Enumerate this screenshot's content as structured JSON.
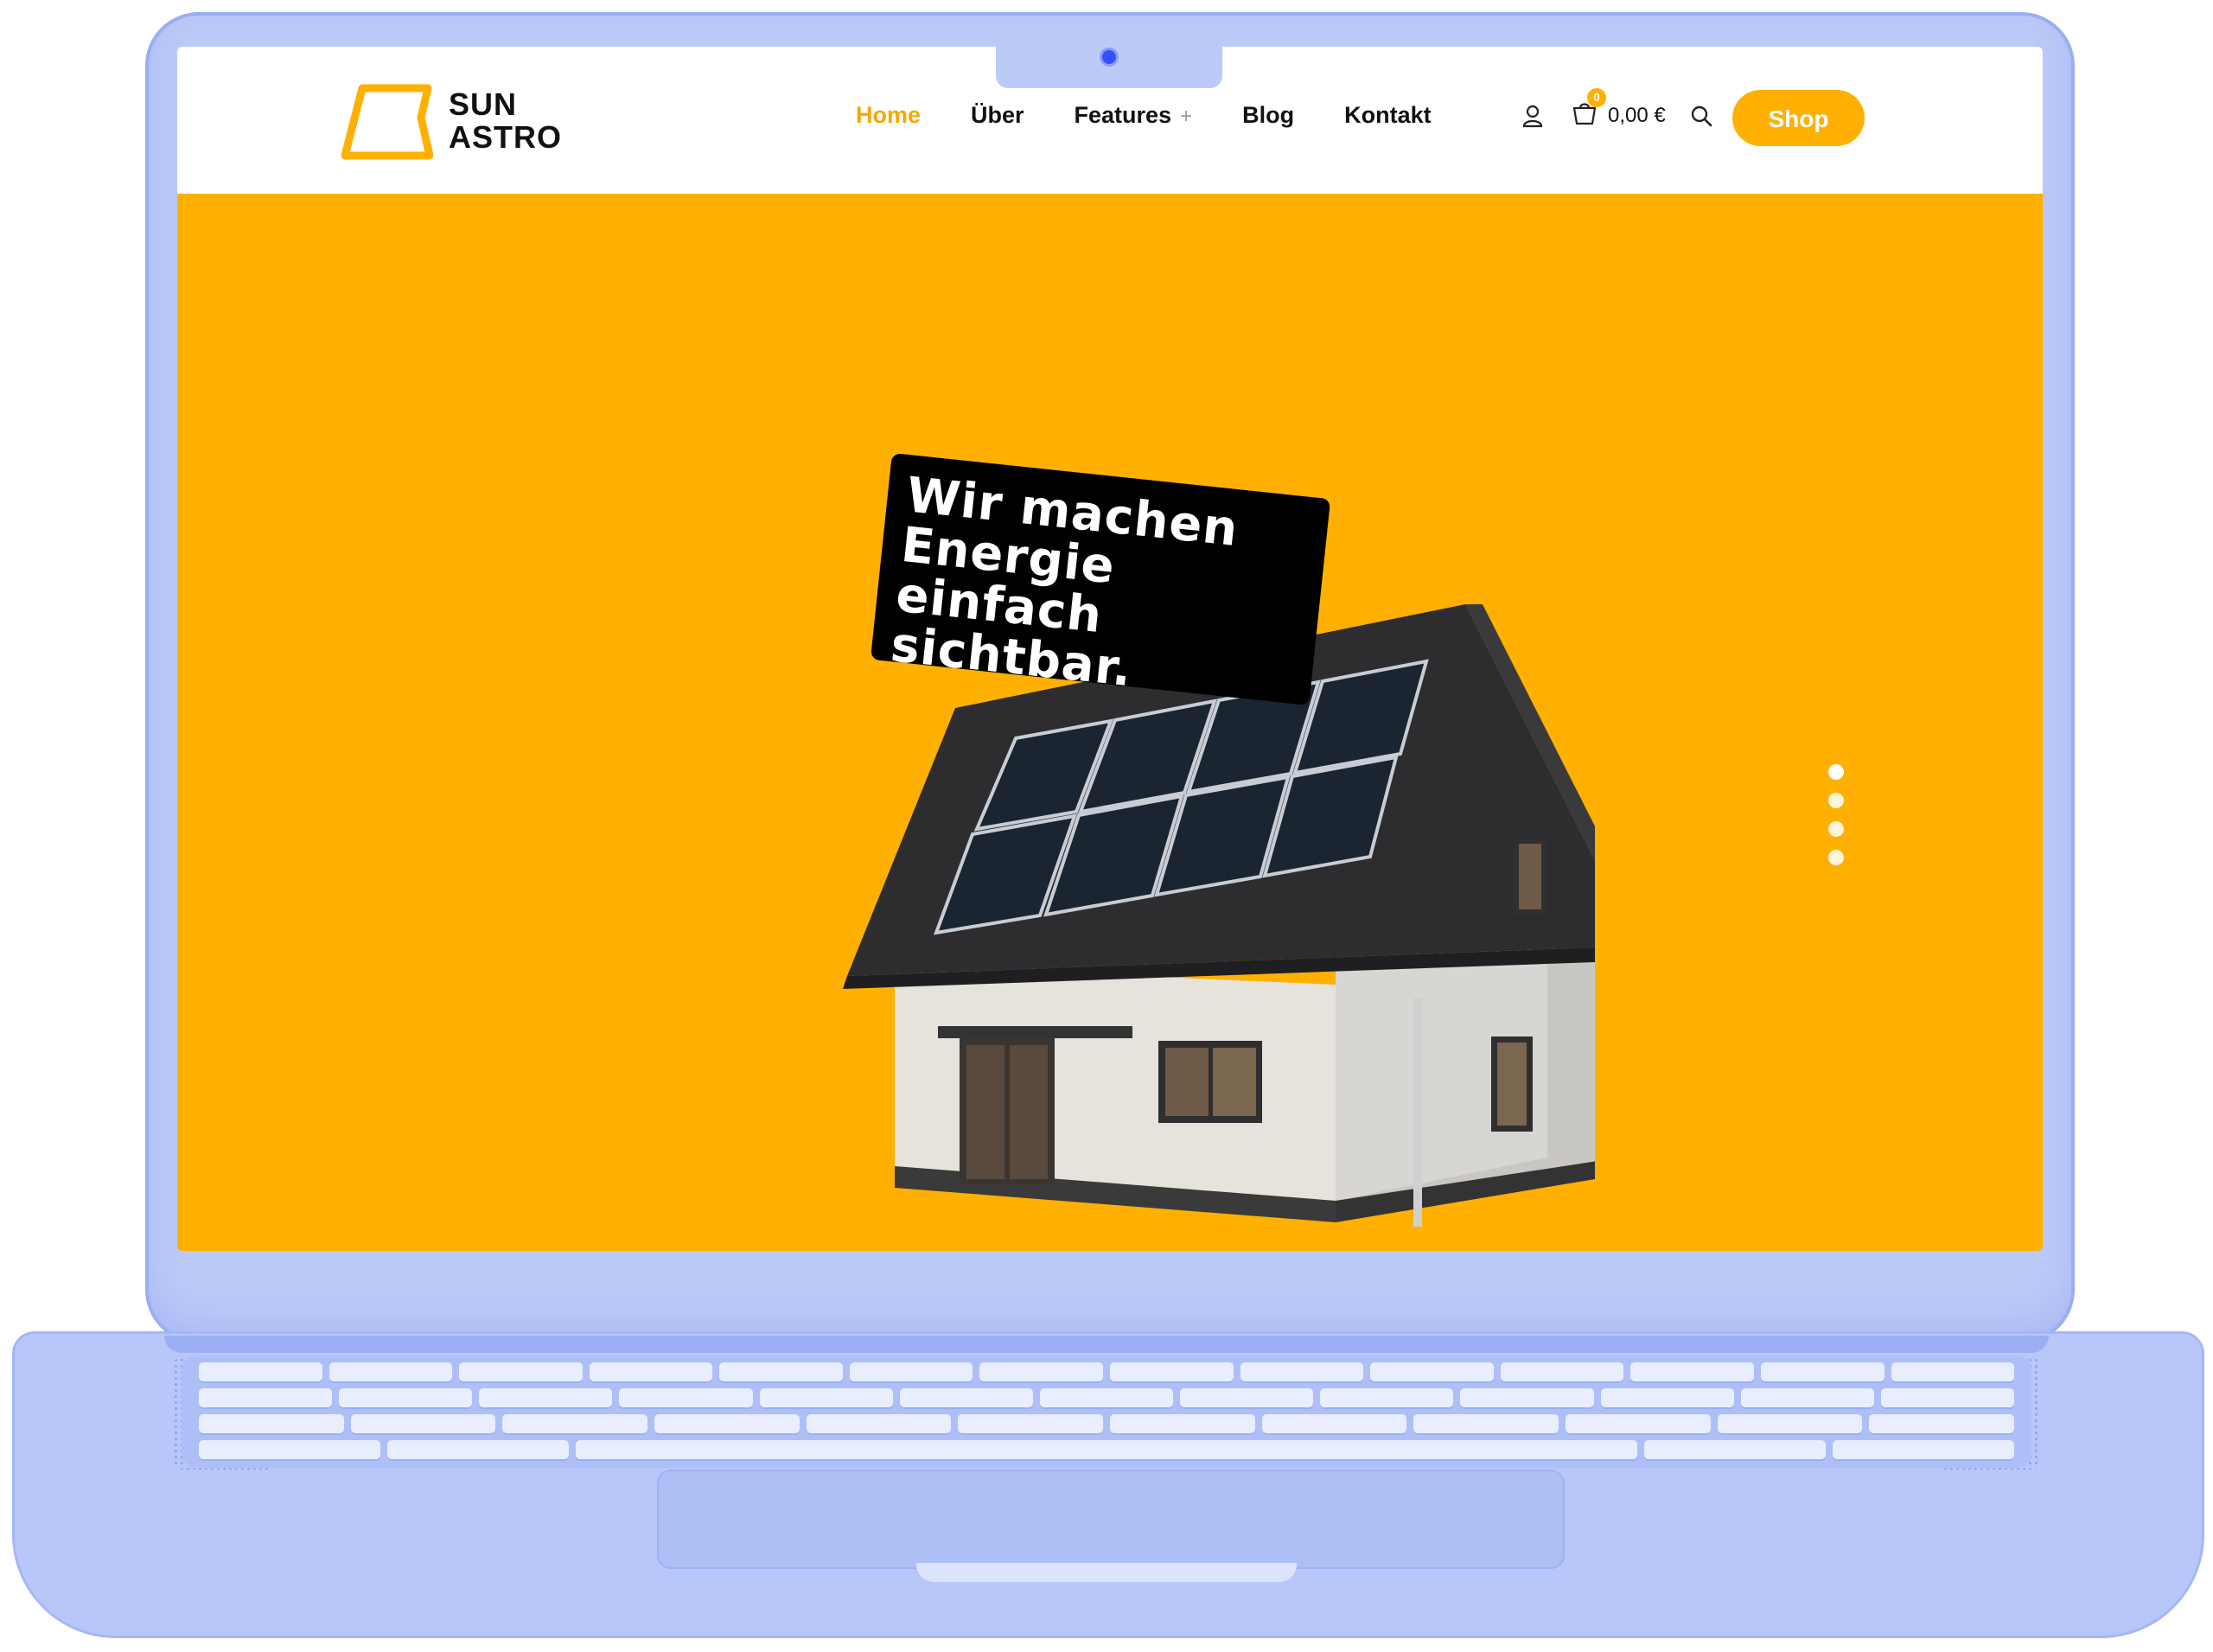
{
  "brand": {
    "name_line1": "SUN",
    "name_line2": "ASTRO",
    "accent_color": "#ffb000"
  },
  "nav": {
    "items": [
      {
        "label": "Home",
        "active": true
      },
      {
        "label": "Über",
        "active": false
      },
      {
        "label": "Features",
        "active": false,
        "has_submenu": true
      },
      {
        "label": "Blog",
        "active": false
      },
      {
        "label": "Kontakt",
        "active": false
      }
    ],
    "submenu_indicator": "+"
  },
  "header_icons": {
    "account_icon": "user-icon",
    "cart_icon": "shopping-bag-icon",
    "cart_count": "0",
    "cart_total": "0,00 €",
    "search_icon": "search-icon"
  },
  "shop_button": {
    "label": "Shop"
  },
  "hero": {
    "headline_line1": "Wir machen",
    "headline_line2": "Energie einfach",
    "headline_line3": "sichtbar.",
    "background_color": "#ffb000",
    "image": "house-with-solar-panels"
  },
  "slider": {
    "slide_count": 4,
    "active_index": 0
  }
}
